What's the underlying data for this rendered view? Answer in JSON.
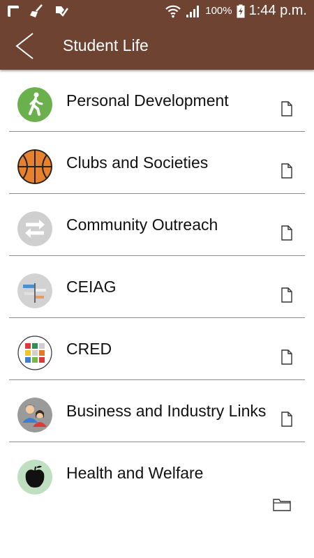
{
  "status": {
    "battery": "100%",
    "time": "1:44 p.m."
  },
  "app": {
    "title": "Student Life"
  },
  "items": [
    {
      "label": "Personal Development",
      "icon": "walking-person-icon",
      "tail": "document-icon"
    },
    {
      "label": "Clubs and Societies",
      "icon": "basketball-icon",
      "tail": "document-icon"
    },
    {
      "label": "Community Outreach",
      "icon": "exchange-arrows-icon",
      "tail": "document-icon"
    },
    {
      "label": "CEIAG",
      "icon": "signpost-icon",
      "tail": "document-icon"
    },
    {
      "label": "CRED",
      "icon": "color-grid-icon",
      "tail": "document-icon"
    },
    {
      "label": "Business and Industry Links",
      "icon": "people-icon",
      "tail": "document-icon"
    },
    {
      "label": "Health and Welfare",
      "icon": "apple-icon",
      "tail": "folder-icon"
    }
  ],
  "colors": {
    "appbar": "#6e4331",
    "divider": "#8b8b8b",
    "green": "#6ab04c",
    "orange": "#e8812e"
  }
}
